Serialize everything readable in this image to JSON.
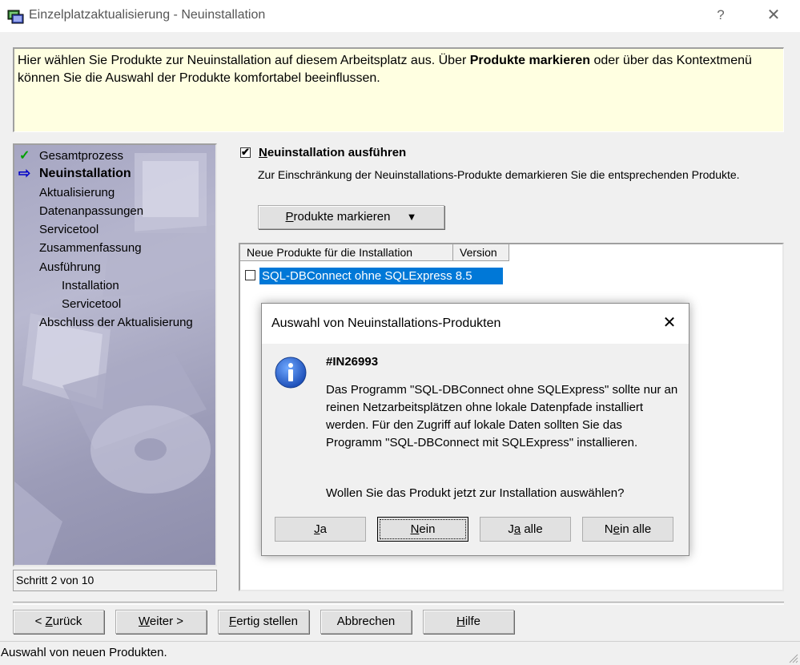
{
  "window": {
    "title": "Einzelplatzaktualisierung - Neuinstallation",
    "help_glyph": "?",
    "close_glyph": "✕"
  },
  "info": {
    "text_1": "Hier wählen Sie Produkte zur Neuinstallation auf diesem Arbeitsplatz aus. Über ",
    "text_bold": "Produkte markieren",
    "text_2": " oder über das Kontextmenü können Sie die Auswahl der Produkte komfortabel beeinflussen."
  },
  "steps": {
    "items": [
      {
        "label": "Gesamtprozess",
        "mark": "✓"
      },
      {
        "label": "Neuinstallation",
        "mark": "⇨"
      },
      {
        "label": "Aktualisierung"
      },
      {
        "label": "Datenanpassungen"
      },
      {
        "label": "Servicetool"
      },
      {
        "label": "Zusammenfassung"
      },
      {
        "label": "Ausführung"
      },
      {
        "label": "Installation"
      },
      {
        "label": "Servicetool"
      },
      {
        "label": "Abschluss der Aktualisierung"
      }
    ],
    "counter": "Schritt 2 von 10"
  },
  "main": {
    "execute_checkbox": {
      "label_u": "N",
      "label_rest": "euinstallation ausführen",
      "checked": true
    },
    "description": "Zur Einschränkung der Neuinstallations-Produkte demarkieren Sie die entsprechenden Produkte.",
    "mark_button": {
      "label_u": "P",
      "label_rest": "rodukte markieren",
      "arrow": "▼"
    },
    "list": {
      "columns": [
        "Neue Produkte für die Installation",
        "Version"
      ],
      "rows": [
        {
          "product": "SQL-DBConnect ohne SQLExpress",
          "version": "8.5",
          "checked": false
        }
      ]
    }
  },
  "footer": {
    "back": {
      "pre": "< ",
      "u": "Z",
      "rest": "urück"
    },
    "next": {
      "u": "W",
      "rest": "eiter >"
    },
    "finish": {
      "u": "F",
      "rest": "ertig stellen"
    },
    "cancel": "Abbrechen",
    "help": {
      "u": "H",
      "rest": "ilfe"
    }
  },
  "status": "Auswahl von neuen Produkten.",
  "dialog": {
    "title": "Auswahl von Neuinstallations-Produkten",
    "close_glyph": "✕",
    "code": "#IN26993",
    "body": "Das Programm \"SQL-DBConnect ohne SQLExpress\" sollte nur an reinen Netzarbeitsplätzen ohne lokale Datenpfade installiert werden. Für den Zugriff auf lokale Daten sollten Sie das Programm \"SQL-DBConnect mit SQLExpress\" installieren.",
    "question": "Wollen Sie das Produkt jetzt zur Installation auswählen?",
    "buttons": {
      "yes": {
        "u": "J",
        "rest": "a"
      },
      "no": {
        "u": "N",
        "rest": "ein"
      },
      "yes_all": {
        "pre": "J",
        "u": "a",
        "rest": " alle"
      },
      "no_all": {
        "pre": "N",
        "u": "e",
        "rest": "in alle"
      }
    }
  },
  "colors": {
    "selection": "#0078d7",
    "info_bg": "#ffffe1",
    "check_green": "#00a000",
    "arrow_blue": "#0000c8"
  }
}
